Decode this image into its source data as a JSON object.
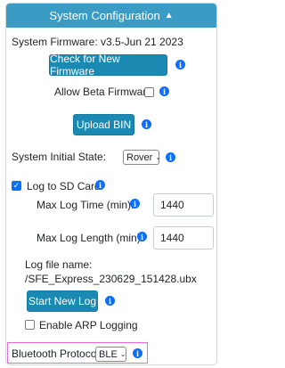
{
  "header": {
    "title": "System Configuration",
    "caret": "▲"
  },
  "firmware": {
    "label": "System Firmware: v3.5-Jun 21 2023",
    "check_button": "Check for New Firmware",
    "beta_label": "Allow Beta Firmware",
    "beta_checked": false,
    "upload_button": "Upload BIN"
  },
  "initial_state": {
    "label": "System Initial State:",
    "selected": "Rover"
  },
  "logging": {
    "log_sd_label": "Log to SD Card",
    "log_sd_checked": true,
    "max_time_label": "Max Log Time (min):",
    "max_time_value": "1440",
    "max_length_label": "Max Log Length (min):",
    "max_length_value": "1440",
    "filename_label": "Log file name:",
    "filename_value": "/SFE_Express_230629_151428.ubx",
    "new_log_button": "Start New Log",
    "arp_label": "Enable ARP Logging",
    "arp_checked": false
  },
  "bluetooth": {
    "label": "Bluetooth Protocol:",
    "selected": "BLE"
  },
  "icons": {
    "info": "i",
    "check": "✓",
    "chevron": "⌄"
  },
  "colors": {
    "header_bg": "#3a9cc5",
    "button_bg": "#1a8ab3",
    "info_icon": "#0d6efd",
    "highlight_border": "#e56bd8"
  }
}
